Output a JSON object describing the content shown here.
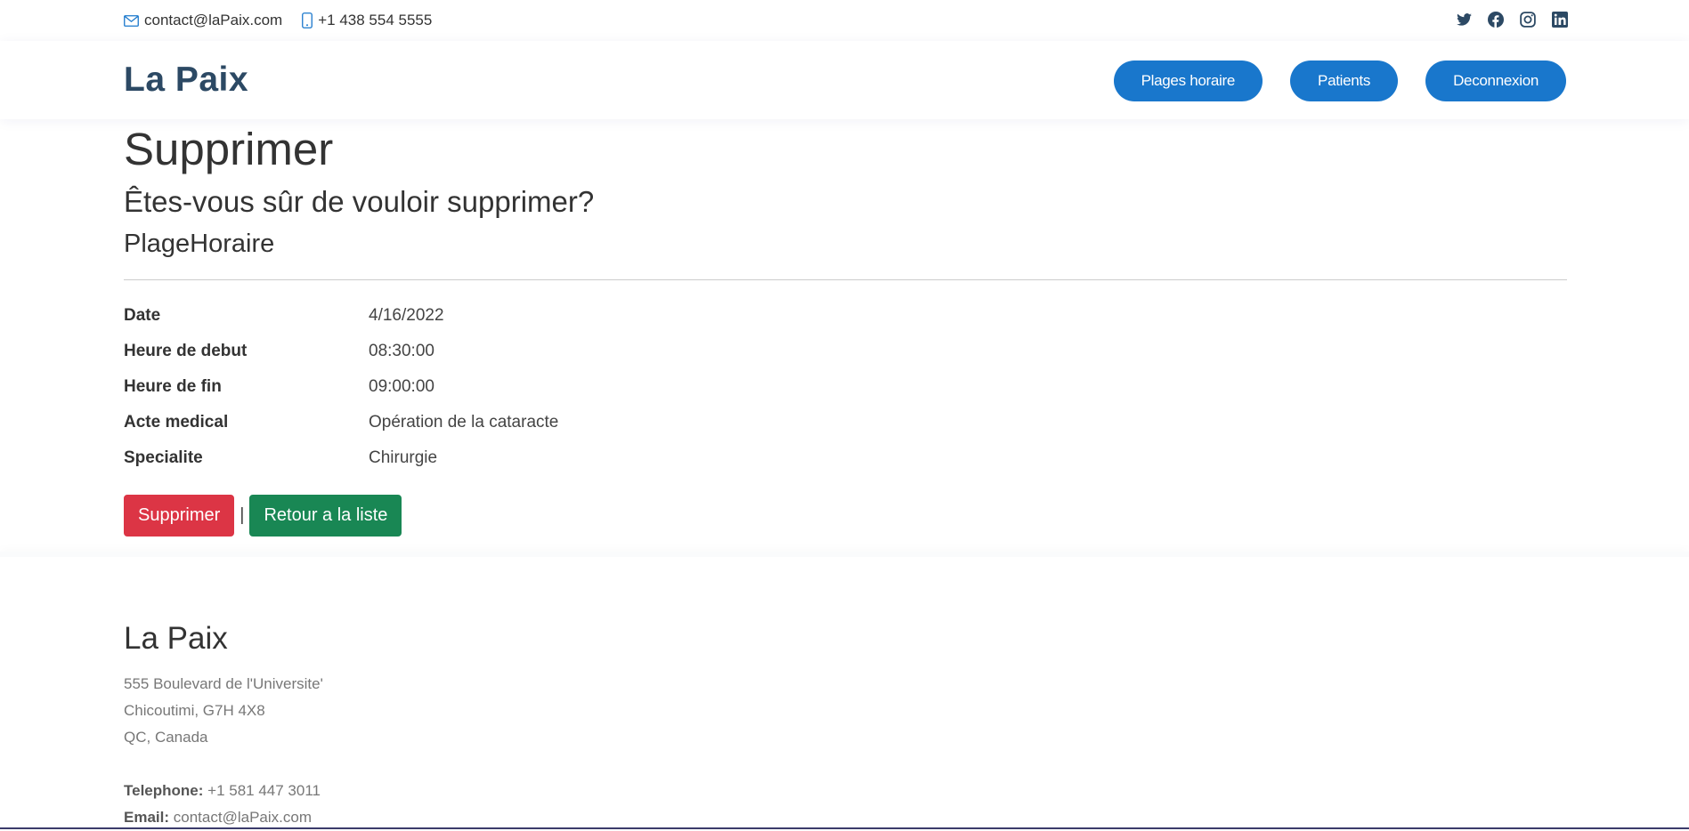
{
  "topbar": {
    "email": "contact@laPaix.com",
    "phone": "+1 438 554 5555",
    "icons": [
      "envelope-icon",
      "phone-icon",
      "twitter-icon",
      "facebook-icon",
      "instagram-icon",
      "linkedin-icon"
    ]
  },
  "header": {
    "logo": "La Paix",
    "nav": [
      {
        "label": "Plages horaire"
      },
      {
        "label": "Patients"
      },
      {
        "label": "Deconnexion"
      }
    ]
  },
  "main": {
    "title": "Supprimer",
    "question": "Êtes-vous sûr de vouloir supprimer?",
    "entity": "PlageHoraire",
    "details": [
      {
        "label": "Date",
        "value": "4/16/2022"
      },
      {
        "label": "Heure de debut",
        "value": "08:30:00"
      },
      {
        "label": "Heure de fin",
        "value": "09:00:00"
      },
      {
        "label": "Acte medical",
        "value": "Opération de la cataracte"
      },
      {
        "label": "Specialite",
        "value": "Chirurgie"
      }
    ],
    "delete_label": "Supprimer",
    "separator": "|",
    "back_label": "Retour a la liste"
  },
  "footer": {
    "name": "La Paix",
    "address_line1": "555 Boulevard de l'Universite'",
    "address_line2": "Chicoutimi, G7H 4X8",
    "address_line3": "QC, Canada",
    "telephone_label": "Telephone:",
    "telephone": "+1 581 447 3011",
    "email_label": "Email:",
    "email": "contact@laPaix.com"
  },
  "colors": {
    "brand": "#2c4964",
    "nav_button": "#1977cc",
    "danger": "#dc3545",
    "success": "#198754"
  }
}
